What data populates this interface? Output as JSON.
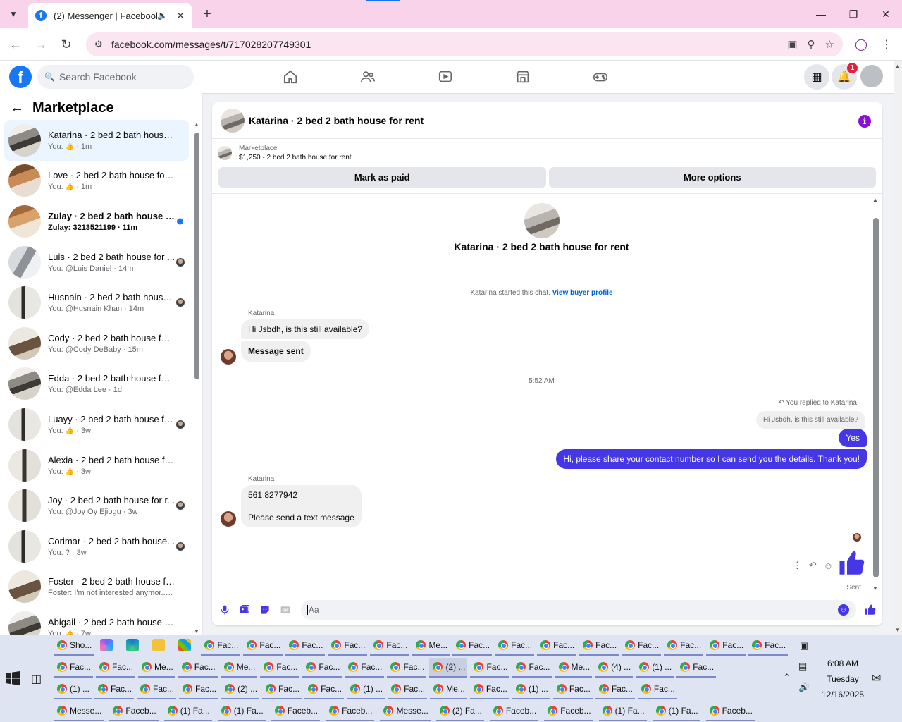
{
  "browser": {
    "tab_title": "(2) Messenger | Facebook",
    "tab_favicon": "facebook-icon",
    "url": "facebook.com/messages/t/717028207749301",
    "accent": "#f9d3ea"
  },
  "fb_header": {
    "search_placeholder": "Search Facebook",
    "notification_count": "1",
    "nav_icons": [
      "home-icon",
      "friends-icon",
      "video-icon",
      "marketplace-icon",
      "gaming-icon"
    ],
    "right_icons": [
      "menu-grid-icon",
      "bell-icon",
      "profile-avatar"
    ]
  },
  "sidebar": {
    "title": "Marketplace",
    "conversations": [
      {
        "name": "Katarina · 2 bed 2 bath house f...",
        "sub_prefix": "You: ",
        "sub_icon": "like",
        "sub_text": "",
        "time": "1m",
        "indicator": "none",
        "active": true,
        "unread": false
      },
      {
        "name": "Love · 2 bed 2 bath house for re...",
        "sub_prefix": "You: ",
        "sub_icon": "like",
        "sub_text": "",
        "time": "1m",
        "indicator": "none",
        "active": false,
        "unread": false
      },
      {
        "name": "Zulay · 2 bed 2 bath house for...",
        "sub_prefix": "Zulay: ",
        "sub_icon": "",
        "sub_text": "3213521199",
        "time": "11m",
        "indicator": "dot",
        "active": false,
        "unread": true
      },
      {
        "name": "Luis · 2 bed 2 bath house for ...",
        "sub_prefix": "You: ",
        "sub_icon": "",
        "sub_text": "@Luis Daniel",
        "time": "14m",
        "indicator": "avatar",
        "active": false,
        "unread": false
      },
      {
        "name": "Husnain · 2 bed 2 bath house...",
        "sub_prefix": "You: ",
        "sub_icon": "",
        "sub_text": "@Husnain Khan",
        "time": "14m",
        "indicator": "avatar",
        "active": false,
        "unread": false
      },
      {
        "name": "Cody · 2 bed 2 bath house for r...",
        "sub_prefix": "You: ",
        "sub_icon": "",
        "sub_text": "@Cody DeBaby",
        "time": "15m",
        "indicator": "none",
        "active": false,
        "unread": false
      },
      {
        "name": "Edda · 2 bed 2 bath house for r...",
        "sub_prefix": "You: ",
        "sub_icon": "",
        "sub_text": "@Edda Lee",
        "time": "1d",
        "indicator": "none",
        "active": false,
        "unread": false
      },
      {
        "name": "Luayy · 2 bed 2 bath house fo...",
        "sub_prefix": "You: ",
        "sub_icon": "like",
        "sub_text": "",
        "time": "3w",
        "indicator": "avatar",
        "active": false,
        "unread": false
      },
      {
        "name": "Alexia · 2 bed 2 bath house for ...",
        "sub_prefix": "You: ",
        "sub_icon": "like",
        "sub_text": "",
        "time": "3w",
        "indicator": "none",
        "active": false,
        "unread": false
      },
      {
        "name": "Joy · 2 bed 2 bath house for r...",
        "sub_prefix": "You: ",
        "sub_icon": "",
        "sub_text": "@Joy Oy Ejiogu",
        "time": "3w",
        "indicator": "avatar",
        "active": false,
        "unread": false
      },
      {
        "name": "Corimar · 2 bed 2 bath house...",
        "sub_prefix": "You: ",
        "sub_icon": "",
        "sub_text": "?",
        "time": "3w",
        "indicator": "avatar",
        "active": false,
        "unread": false
      },
      {
        "name": "Foster · 2 bed 2 bath house for ...",
        "sub_prefix": "Foster: ",
        "sub_icon": "",
        "sub_text": "I'm not interested anymor...",
        "time": "7w",
        "indicator": "none",
        "active": false,
        "unread": false
      },
      {
        "name": "Abigail · 2 bed 2 bath house for...",
        "sub_prefix": "You: ",
        "sub_icon": "like",
        "sub_text": "",
        "time": "7w",
        "indicator": "none",
        "active": false,
        "unread": false
      }
    ]
  },
  "chat": {
    "header_title": "Katarina · 2 bed 2 bath house for rent",
    "marketplace_label": "Marketplace",
    "listing": "$1,250 - 2 bed 2 bath house for rent",
    "mark_paid_label": "Mark as paid",
    "more_options_label": "More options",
    "intro_title": "Katarina · 2 bed 2 bath house for rent",
    "started_text": "Katarina started this chat. ",
    "view_profile_link": "View buyer profile",
    "sender_name": "Katarina",
    "msg_in_1": "Hi Jsbdh, is this still available?",
    "msg_in_2": "Message sent",
    "time_separator": "5:52 AM",
    "replied_note": "You replied to Katarina",
    "reply_quote": "Hi Jsbdh, is this still available?",
    "msg_out_1": "Yes",
    "msg_out_2": "Hi, please share your contact number so I can send you the details. Thank you!",
    "sender_name_2": "Katarina",
    "msg_in_3a": "561 8277942",
    "msg_in_3b": "Please send a text message",
    "sent_label": "Sent",
    "composer_placeholder": "Aa",
    "accent_color": "#4536e6"
  },
  "taskbar": {
    "rows": [
      [
        "Sho...",
        "",
        "",
        "",
        "",
        "Fac...",
        "Fac...",
        "Fac...",
        "Fac...",
        "Fac...",
        "Me...",
        "Fac...",
        "Fac...",
        "Fac...",
        "Fac...",
        "Fac...",
        "Fac...",
        "Fac...",
        "Fac..."
      ],
      [
        "Fac...",
        "Fac...",
        "Me...",
        "Fac...",
        "Me...",
        "Fac...",
        "Fac...",
        "Fac...",
        "Fac...",
        "(2) ...",
        "Fac...",
        "Fac...",
        "Me...",
        "(4) ...",
        "(1) ...",
        "Fac..."
      ],
      [
        "(1) ...",
        "Fac...",
        "Fac...",
        "Fac...",
        "(2) ...",
        "Fac...",
        "Fac...",
        "(1) ...",
        "Fac...",
        "Me...",
        "Fac...",
        "(1) ...",
        "Fac...",
        "Fac...",
        "Fac..."
      ],
      [
        "Messe...",
        "Faceb...",
        "(1) Fa...",
        "(1) Fa...",
        "Faceb...",
        "Faceb...",
        "Messe...",
        "(2) Fa...",
        "Faceb...",
        "Faceb...",
        "(1) Fa...",
        "(1) Fa...",
        "Faceb..."
      ]
    ],
    "selected_item": "(2) ...",
    "time": "6:08 AM",
    "day": "Tuesday",
    "date": "12/16/2025"
  }
}
